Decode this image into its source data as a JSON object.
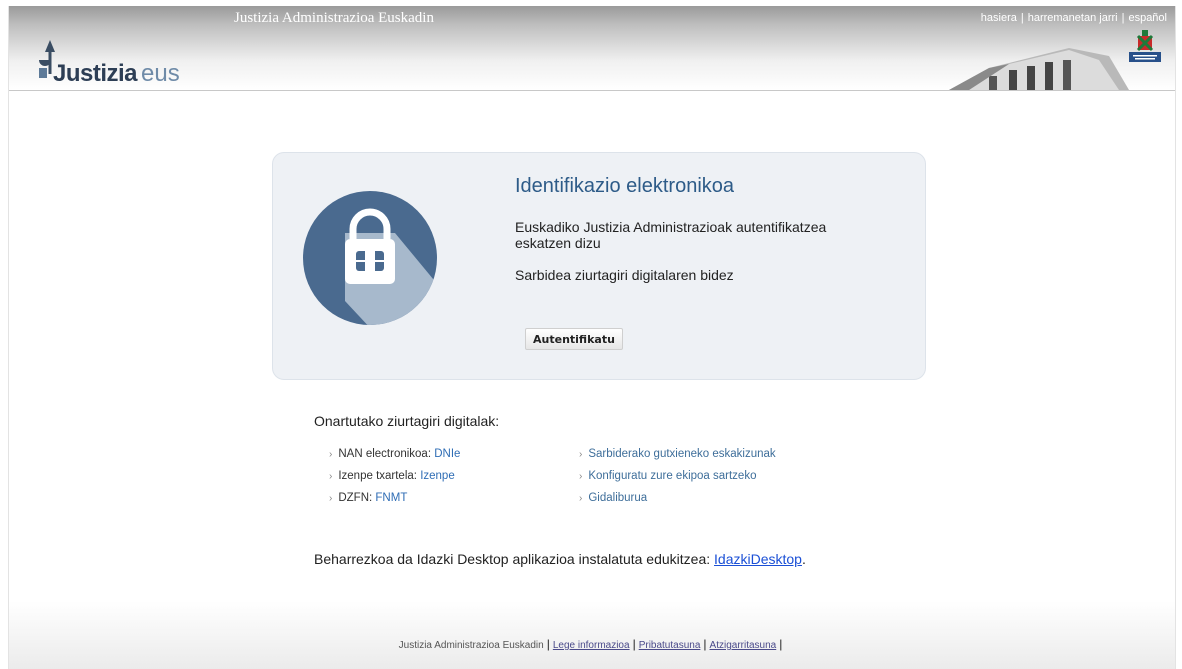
{
  "header": {
    "site_title": "Justizia Administrazioa Euskadin",
    "links": [
      "hasiera",
      "harremanetan jarri",
      "español"
    ],
    "logo_word1": "Justizia",
    "logo_word2": "eus"
  },
  "card": {
    "title": "Identifikazio elektronikoa",
    "description": "Euskadiko Justizia Administrazioak autentifikatzea eskatzen dizu",
    "access_text": "Sarbidea ziurtagiri digitalaren bidez",
    "button_label": "Autentifikatu"
  },
  "accepted": {
    "title": "Onartutako ziurtagiri digitalak:",
    "certs": [
      {
        "label": "NAN electronikoa:",
        "link": "DNIe"
      },
      {
        "label": "Izenpe txartela:",
        "link": "Izenpe"
      },
      {
        "label": "DZFN:",
        "link": "FNMT"
      }
    ],
    "links": [
      "Sarbiderako gutxieneko eskakizunak",
      "Konfiguratu zure ekipoa sartzeko",
      "Gidaliburua"
    ]
  },
  "desktop": {
    "text": "Beharrezkoa da Idazki Desktop aplikazioa instalatuta edukitzea:",
    "link": "IdazkiDesktop",
    "end": "."
  },
  "footer": {
    "site": "Justizia Administrazioa Euskadin",
    "links": [
      "Lege informazioa",
      "Pribatutasuna",
      "Atzigarritasuna"
    ]
  },
  "colors": {
    "accent": "#2d5b88",
    "circle": "#4a6a8f",
    "link": "#2f6db5"
  }
}
